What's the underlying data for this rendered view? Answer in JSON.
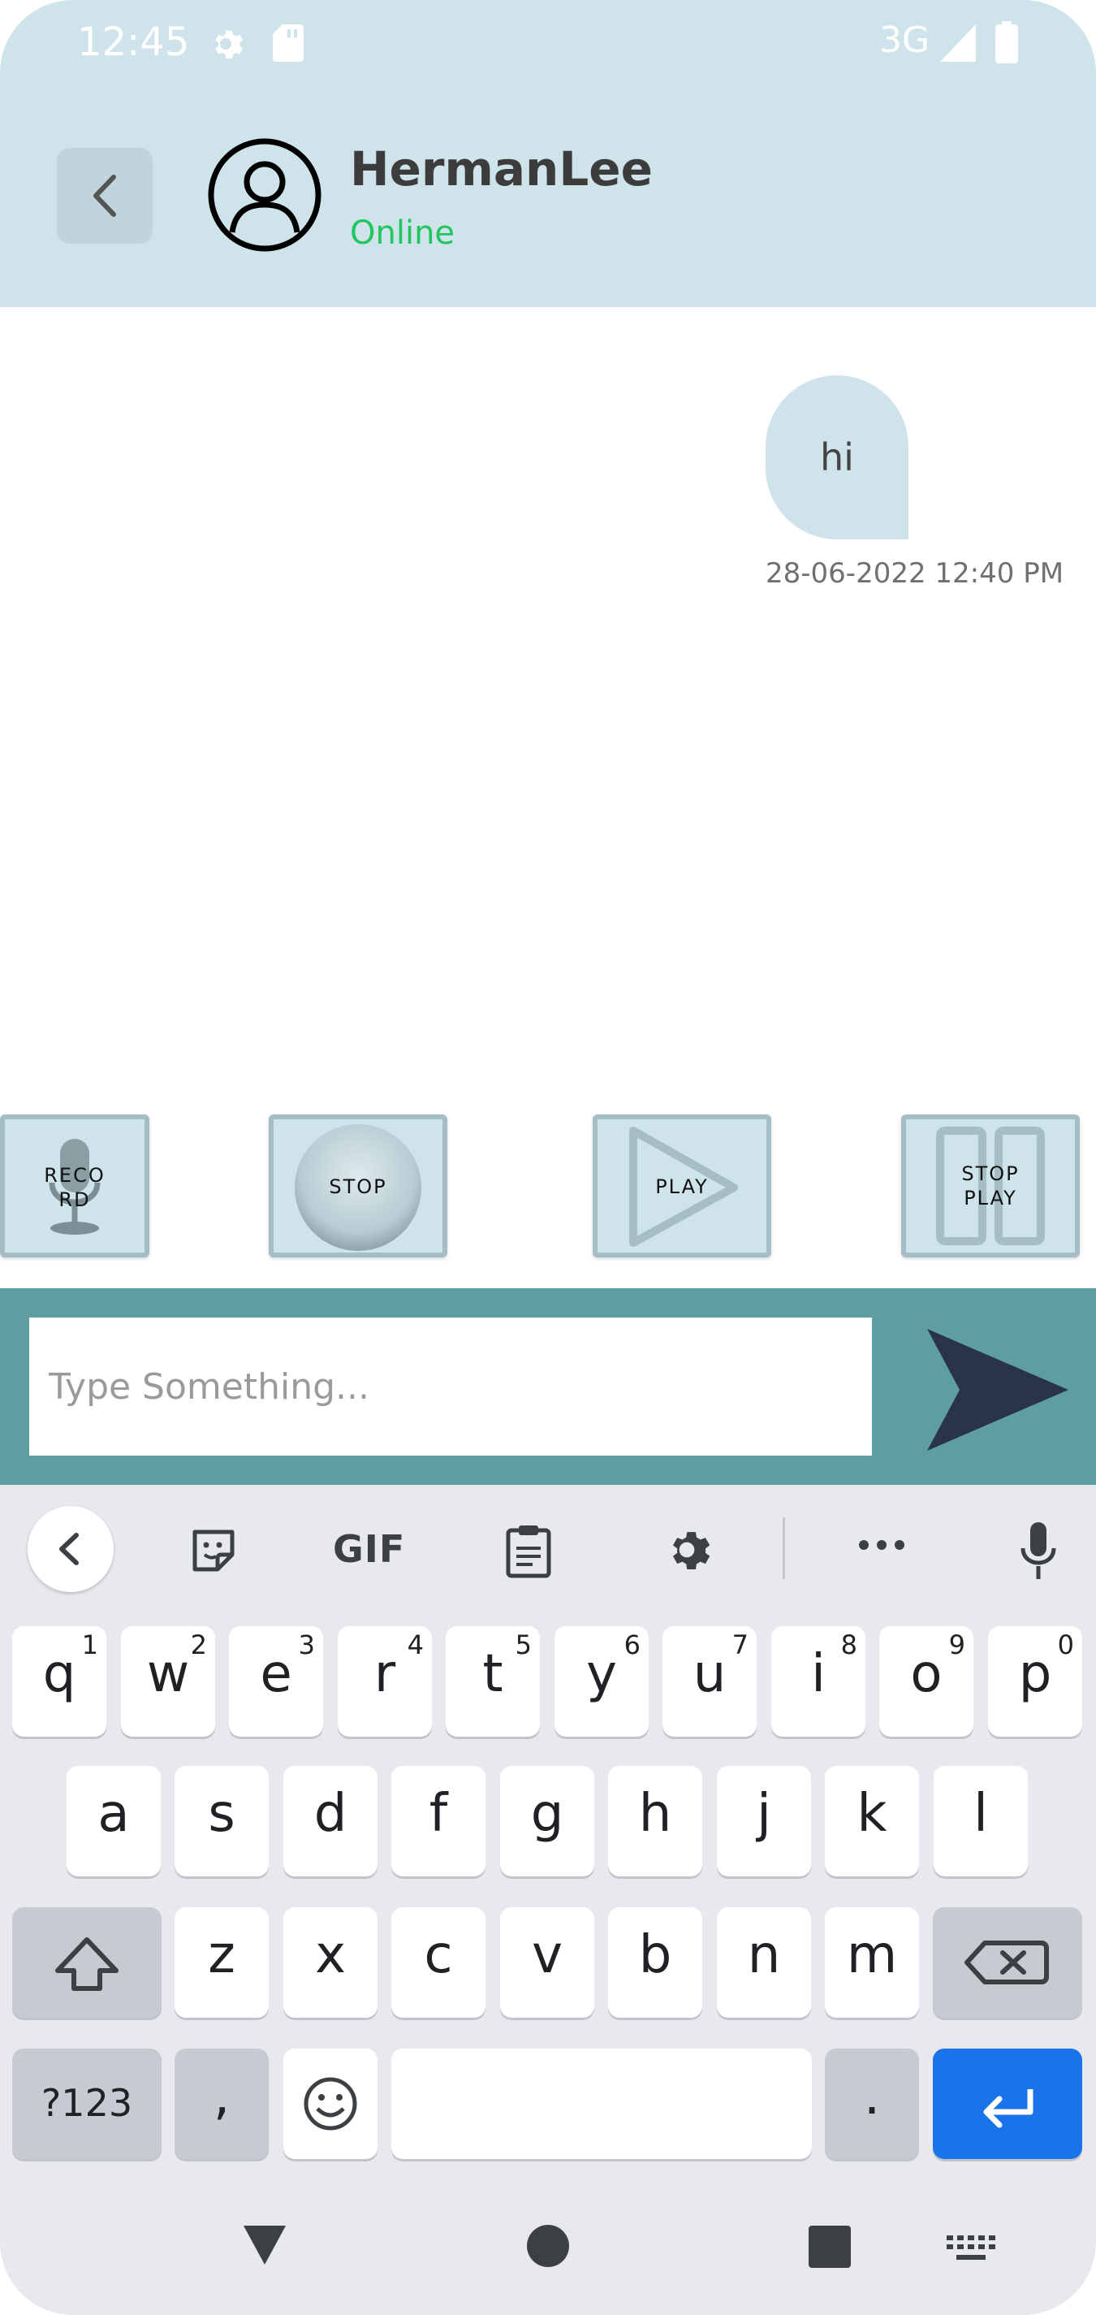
{
  "status_bar": {
    "time": "12:45",
    "network": "3G",
    "icons": [
      "settings-icon",
      "sd-card-icon",
      "signal-icon",
      "battery-icon"
    ]
  },
  "header": {
    "contact_name": "HermanLee",
    "contact_status": "Online",
    "icons": [
      "back-icon",
      "avatar-icon"
    ],
    "colors": {
      "header_bg": "#cfe3ea",
      "online": "#22c55e"
    }
  },
  "messages": [
    {
      "text": "hi",
      "timestamp": "28-06-2022 12:40 PM",
      "sender": "me"
    }
  ],
  "controls": {
    "record_line1": "RECO",
    "record_line2": "RD",
    "stop": "STOP",
    "play": "PLAY",
    "stop_play_line1": "STOP",
    "stop_play_line2": "PLAY"
  },
  "composer": {
    "placeholder": "Type Something...",
    "value": "",
    "send_icon": "send-icon",
    "bg_color": "#5e9ea0"
  },
  "keyboard": {
    "toolbar": [
      "back-icon",
      "sticker-icon",
      "gif-icon",
      "clipboard-icon",
      "settings-icon",
      "more-icon",
      "mic-icon"
    ],
    "gif_label": "GIF",
    "row1": [
      {
        "k": "q",
        "s": "1"
      },
      {
        "k": "w",
        "s": "2"
      },
      {
        "k": "e",
        "s": "3"
      },
      {
        "k": "r",
        "s": "4"
      },
      {
        "k": "t",
        "s": "5"
      },
      {
        "k": "y",
        "s": "6"
      },
      {
        "k": "u",
        "s": "7"
      },
      {
        "k": "i",
        "s": "8"
      },
      {
        "k": "o",
        "s": "9"
      },
      {
        "k": "p",
        "s": "0"
      }
    ],
    "row2": [
      "a",
      "s",
      "d",
      "f",
      "g",
      "h",
      "j",
      "k",
      "l"
    ],
    "row3": [
      "z",
      "x",
      "c",
      "v",
      "b",
      "n",
      "m"
    ],
    "symbols_label": "?123",
    "comma": ",",
    "period": "."
  },
  "navigation": [
    "back-triangle-icon",
    "home-circle-icon",
    "recents-square-icon",
    "keyboard-switch-icon"
  ]
}
